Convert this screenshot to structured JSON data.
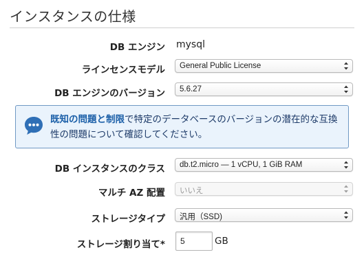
{
  "section": {
    "title": "インスタンスの仕様"
  },
  "fields": {
    "db_engine": {
      "label": "DB エンジン",
      "value": "mysql"
    },
    "license_model": {
      "label": "ラインセンスモデル",
      "value": "General Public License"
    },
    "engine_version": {
      "label": "DB エンジンのバージョン",
      "value": "5.6.27"
    },
    "instance_class": {
      "label": "DB インスタンスのクラス",
      "value": "db.t2.micro — 1 vCPU, 1 GiB RAM"
    },
    "multi_az": {
      "label": "マルチ AZ 配置",
      "value": "いいえ",
      "disabled": true
    },
    "storage_type": {
      "label": "ストレージタイプ",
      "value": "汎用（SSD)"
    },
    "allocated_storage": {
      "label": "ストレージ割り当て*",
      "value": "5",
      "unit": "GB"
    }
  },
  "info": {
    "link_text": "既知の問題と制限",
    "text": "で特定のデータベースのバージョンの潜在的な互換性の問題について確認してください。",
    "colors": {
      "border": "#6f98c4",
      "background": "#eaf3fc",
      "icon": "#2f6fb6"
    },
    "icon": "speech-bubble-icon"
  }
}
